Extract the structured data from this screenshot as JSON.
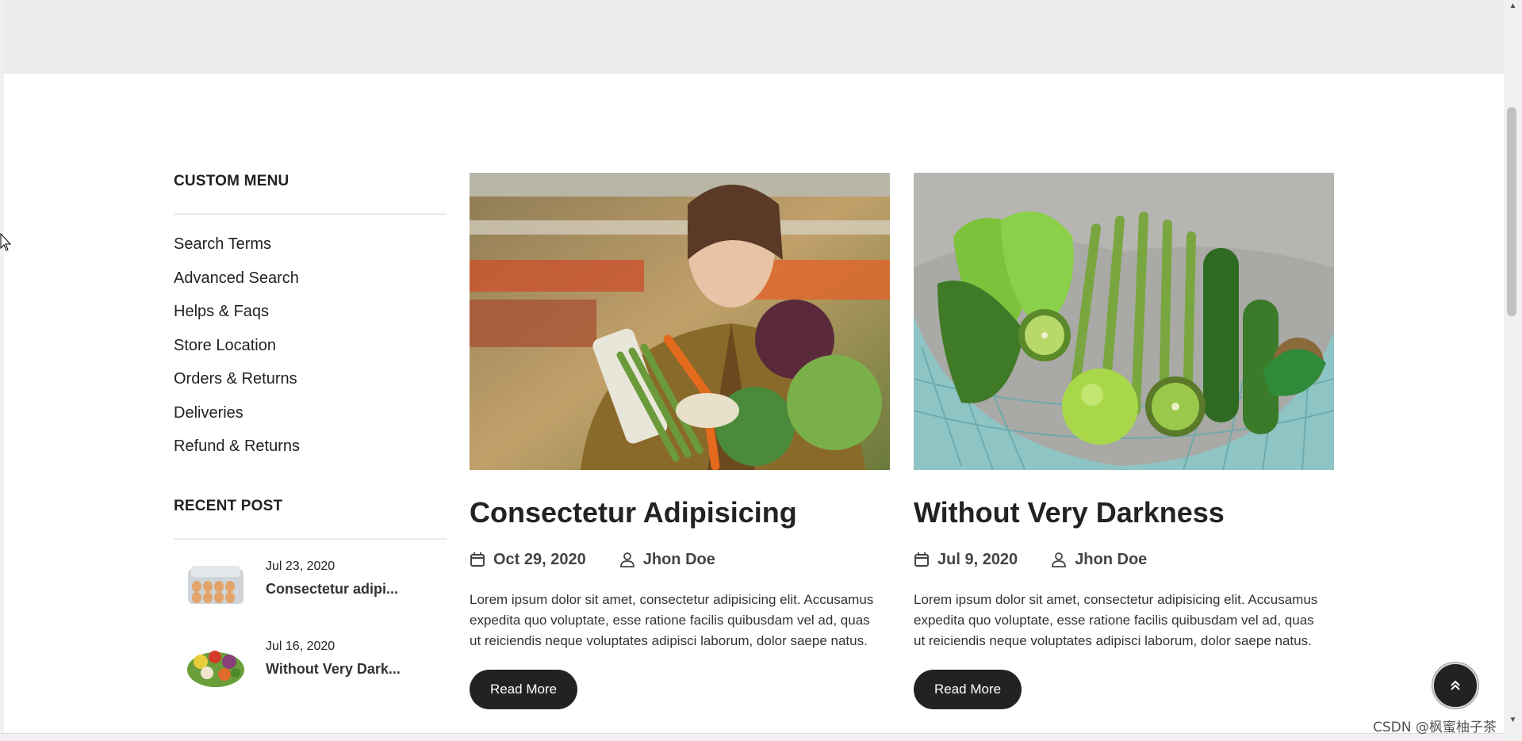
{
  "sidebar": {
    "custom_menu_title": "CUSTOM MENU",
    "menu_items": [
      "Search Terms",
      "Advanced Search",
      "Helps & Faqs",
      "Store Location",
      "Orders & Returns",
      "Deliveries",
      "Refund & Returns"
    ],
    "recent_post_title": "RECENT POST",
    "recent_posts": [
      {
        "date": "Jul 23, 2020",
        "title": "Consectetur adipi...",
        "thumb": "egg-carton-image"
      },
      {
        "date": "Jul 16, 2020",
        "title": "Without Very Dark...",
        "thumb": "vegetables-pile-image"
      }
    ]
  },
  "posts": [
    {
      "image": "woman-holding-vegetables-image",
      "title": "Consectetur Adipisicing",
      "date": "Oct 29, 2020",
      "author": "Jhon Doe",
      "excerpt": "Lorem ipsum dolor sit amet, consectetur adipisicing elit. Accusamus expedita quo voluptate, esse ratione facilis quibusdam vel ad, quas ut reiciendis neque voluptates adipisci laborum, dolor saepe natus.",
      "button": "Read More"
    },
    {
      "image": "vegetables-in-mesh-bag-image",
      "title": "Without Very Darkness",
      "date": "Jul 9, 2020",
      "author": "Jhon Doe",
      "excerpt": "Lorem ipsum dolor sit amet, consectetur adipisicing elit. Accusamus expedita quo voluptate, esse ratione facilis quibusdam vel ad, quas ut reiciendis neque voluptates adipisci laborum, dolor saepe natus.",
      "button": "Read More"
    }
  ],
  "icons": {
    "calendar": "calendar-icon",
    "user": "user-icon",
    "back_to_top": "double-chevron-up-icon"
  },
  "watermark": "CSDN @枫蜜柚子茶",
  "colors": {
    "dark": "#222222",
    "top_band": "#ebebeb"
  }
}
